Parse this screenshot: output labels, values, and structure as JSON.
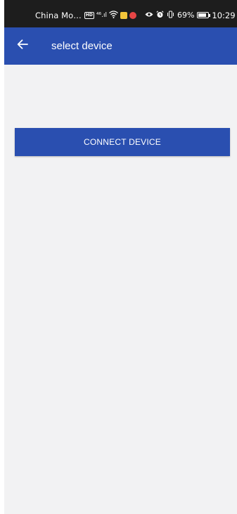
{
  "status_bar": {
    "carrier": "China Mo…",
    "signal_text": "⁴⁶.ıl",
    "hd_badge": "HD",
    "battery_percent": "69%",
    "battery_level": 0.69,
    "time": "10:29"
  },
  "app_bar": {
    "title": "select device",
    "back_icon": "arrow-left-icon"
  },
  "main": {
    "connect_button_label": "CONNECT DEVICE"
  },
  "colors": {
    "primary": "#2a4fb0",
    "background": "#f2f2f3",
    "status_bar": "#1d1d1d"
  }
}
